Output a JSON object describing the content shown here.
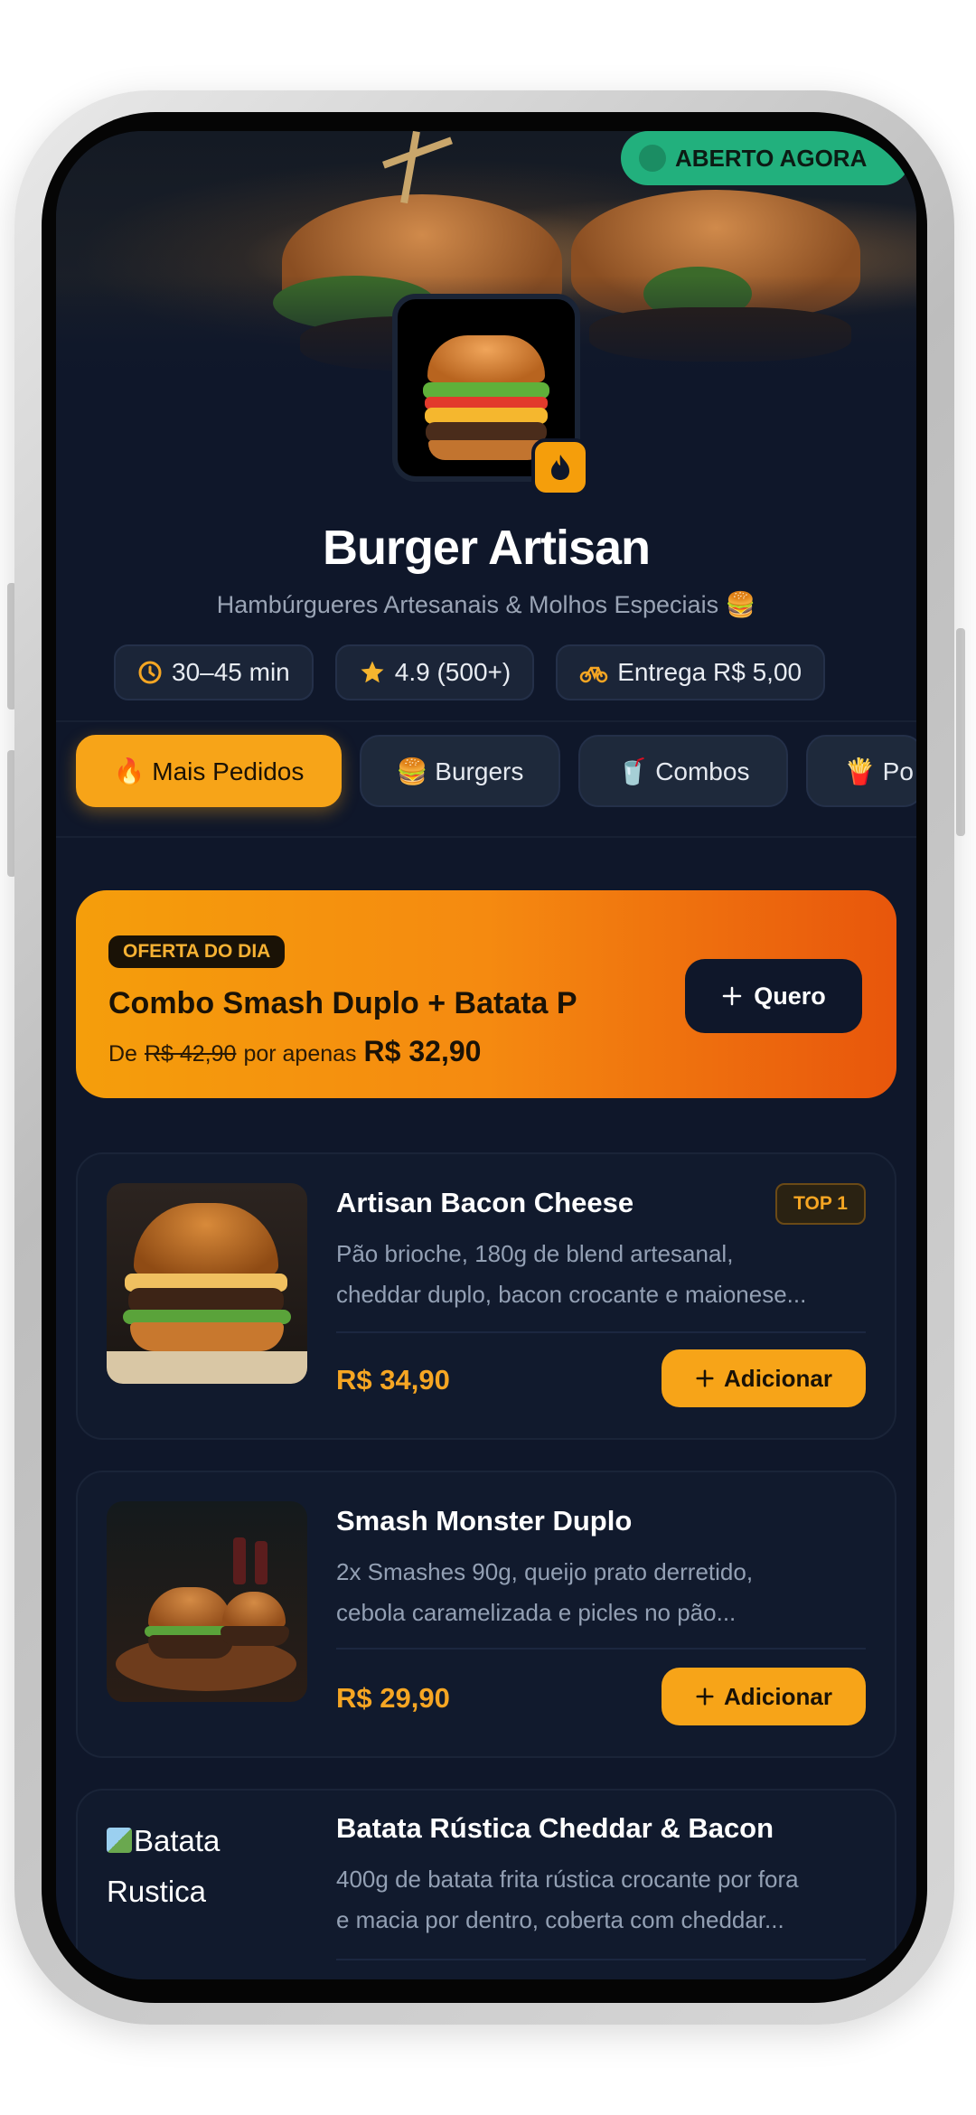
{
  "status_badge": "ABERTO AGORA",
  "store": {
    "name": "Burger Artisan",
    "subtitle": "Hambúrgueres Artesanais & Molhos Especiais 🍔"
  },
  "info_chips": [
    {
      "icon": "clock-icon",
      "label": "30–45 min"
    },
    {
      "icon": "star-icon",
      "label": "4.9 (500+)"
    },
    {
      "icon": "bike-icon",
      "label": "Entrega R$ 5,00"
    }
  ],
  "tabs": [
    {
      "label": "🔥 Mais Pedidos",
      "active": true
    },
    {
      "label": "🍔 Burgers",
      "active": false
    },
    {
      "label": "🥤 Combos",
      "active": false
    },
    {
      "label": "🍟 Po",
      "active": false
    }
  ],
  "offer": {
    "tag": "OFERTA DO DIA",
    "title": "Combo Smash Duplo + Batata P",
    "prefix": "De",
    "old_price": "R$ 42,90",
    "middle": "por apenas",
    "new_price": "R$ 32,90",
    "button": "Quero"
  },
  "products": [
    {
      "name": "Artisan Bacon Cheese",
      "badge": "TOP 1",
      "desc_line1": "Pão brioche, 180g de blend artesanal,",
      "desc_line2": "cheddar duplo, bacon crocante e maionese...",
      "price": "R$ 34,90",
      "button": "Adicionar"
    },
    {
      "name": "Smash Monster Duplo",
      "desc_line1": "2x Smashes 90g, queijo prato derretido,",
      "desc_line2": "cebola caramelizada e picles no pão...",
      "price": "R$ 29,90",
      "button": "Adicionar"
    },
    {
      "name": "Batata Rústica Cheddar & Bacon",
      "image_alt": "Batata Rustica",
      "desc_line1": "400g de batata frita rústica crocante por fora",
      "desc_line2": "e macia por dentro, coberta com cheddar..."
    }
  ],
  "colors": {
    "background": "#0f172a",
    "accent": "#f7a418",
    "open_green": "#22b07d"
  }
}
